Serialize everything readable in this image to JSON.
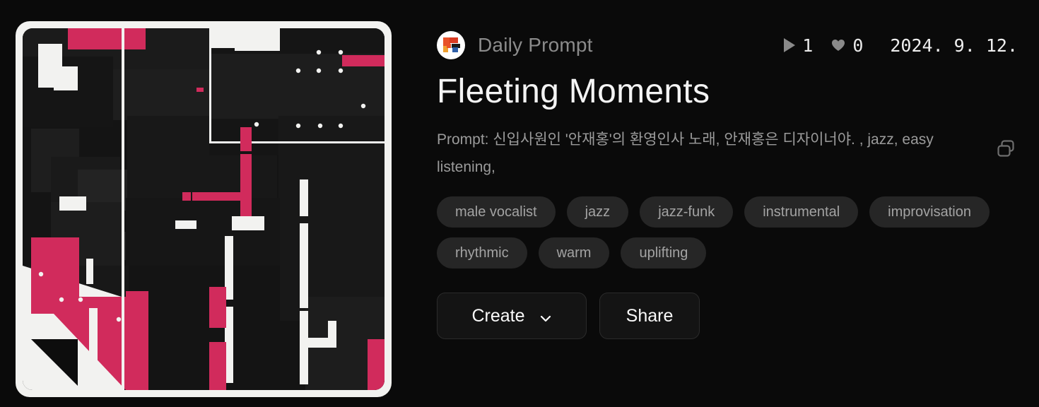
{
  "theme": {
    "background": "#0a0a0a",
    "accent_pink": "#d12b5c",
    "art_frame": "#f2f2f0",
    "art_base": "#141414",
    "tag_bg": "#262626",
    "muted_text": "#9b9b9b"
  },
  "artwork": {
    "alt": "abstract geometric album cover with dark blocks, crimson bars and white rectangles",
    "icon_name": "album-artwork"
  },
  "header": {
    "avatar_name": "channel-avatar",
    "channel": "Daily Prompt",
    "stats": {
      "play_icon": "play-icon",
      "plays": "1",
      "like_icon": "heart-icon",
      "likes": "0",
      "date": "2024. 9. 12."
    }
  },
  "main": {
    "title": "Fleeting Moments",
    "prompt": "Prompt: 신입사원인 '안재홍'의 환영인사 노래, 안재홍은 디자이너야. , jazz, easy listening,",
    "copy_icon": "copy-icon",
    "tags": [
      "male vocalist",
      "jazz",
      "jazz-funk",
      "instrumental",
      "improvisation",
      "rhythmic",
      "warm",
      "uplifting"
    ],
    "actions": {
      "create_label": "Create",
      "create_chevron": "chevron-down-icon",
      "share_label": "Share"
    }
  }
}
